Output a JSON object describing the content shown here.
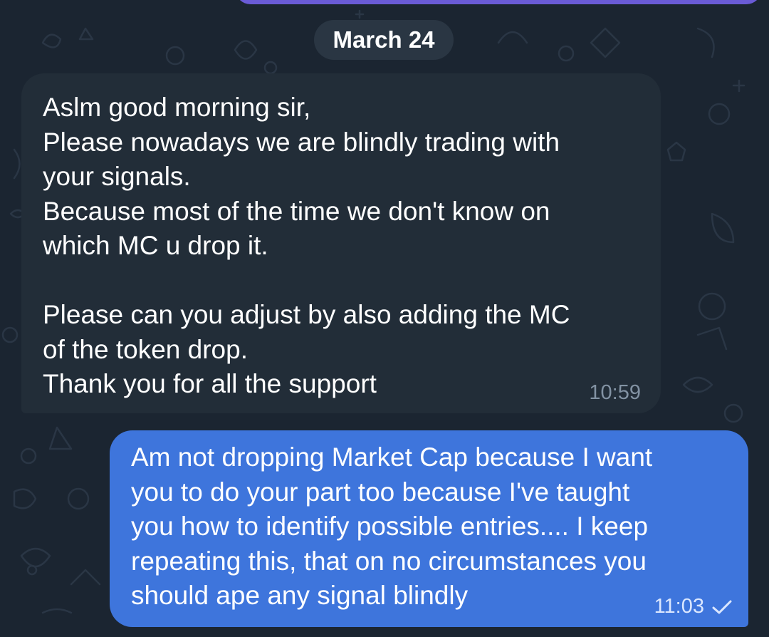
{
  "date_separator": "March 24",
  "colors": {
    "background": "#1b2531",
    "incoming_bubble": "#222d38",
    "outgoing_bubble": "#3e75dc",
    "date_chip": "#2a3643",
    "previous_bubble_edge": "#6a5bd6"
  },
  "messages": [
    {
      "direction": "incoming",
      "lines": [
        "Aslm good morning sir,",
        "Please nowadays we are blindly trading with",
        "your signals.",
        "Because most of the time we don't know on",
        "which MC u drop it.",
        "",
        "Please can you adjust by also adding the MC",
        "of the token drop.",
        "Thank you for all the support"
      ],
      "time": "10:59"
    },
    {
      "direction": "outgoing",
      "lines": [
        "Am not dropping Market Cap because I want",
        "you to do your part too because I've taught",
        "you how to identify possible entries.... I keep",
        "repeating this, that on no circumstances you",
        "should ape any signal blindly"
      ],
      "time": "11:03",
      "status_icon": "single-check-icon"
    }
  ]
}
